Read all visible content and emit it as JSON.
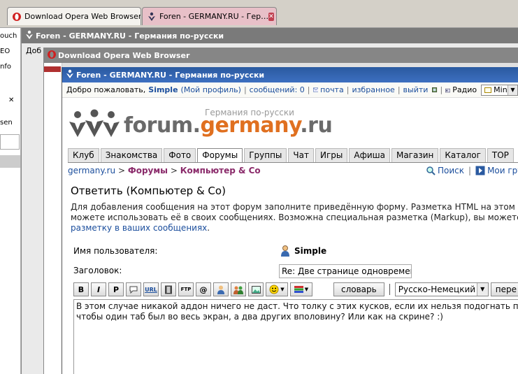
{
  "browser_tabs": [
    {
      "title": "Download Opera Web Browser",
      "active": true
    },
    {
      "title": "Foren - GERMANY.RU - Гер…",
      "active": false
    }
  ],
  "left_sliver": {
    "items": [
      "ouch",
      "EO",
      "nfo",
      "sen"
    ],
    "close_glyph": "✕"
  },
  "back_window1": {
    "title": "Foren - GERMANY.RU - Германия по-русски",
    "sub_text": "Доб"
  },
  "back_window2": {
    "title": "Download Opera Web Browser"
  },
  "window": {
    "title": "Foren - GERMANY.RU - Германия по-русски"
  },
  "welcome": {
    "greeting": "Добро пожаловать,",
    "user": "Simple",
    "profile": "(Мой профиль)",
    "messages": "сообщений: 0",
    "mail": "почта",
    "favorites": "избранное",
    "logout": "выйти",
    "radio": "Радио",
    "player_mode": "Mini"
  },
  "logo": {
    "tagline": "Германия по-русски",
    "part1": "forum.",
    "part2": "germany",
    "part3": ".ru"
  },
  "nav_tabs": [
    "Клуб",
    "Знакомства",
    "Фото",
    "Форумы",
    "Группы",
    "Чат",
    "Игры",
    "Афиша",
    "Магазин",
    "Каталог",
    "TOP"
  ],
  "nav_active": "Форумы",
  "breadcrumb": {
    "home": "germany.ru",
    "sep1": " > ",
    "forums": "Форумы",
    "sep2": " > ",
    "current": "Компьютер & Co"
  },
  "right_links": {
    "search": "Поиск",
    "my_groups": "Мои гру"
  },
  "page_title": "Ответить (Компьютер & Co)",
  "description": {
    "line1": "Для добавления сообщения на этот форум заполните приведённую форму. Разметка HTML на этом форуме",
    "line2": "можете использовать её в своих сообщениях. Возможна специальная разметка (Markup), вы можете испол",
    "line3_link": "разметку в ваших сообщениях",
    "line3_end": "."
  },
  "form": {
    "username_label": "Имя пользователя:",
    "username_value": "Simple",
    "subject_label": "Заголовок:",
    "subject_value": "Re: Две странице одновремено"
  },
  "toolbar": {
    "bold": "B",
    "italic": "I",
    "pre": "P",
    "url": "URL",
    "ftp": "FTP",
    "at": "@",
    "dictionary_button": "словарь",
    "dictionary_select": "Русско-Немецкий",
    "translate_button": "пере"
  },
  "message": {
    "body": "В этом случае никакой аддон ничего не даст. Что толку с этих кусков, если их нельзя подогнать по ширине?\nчтобы один таб был во весь экран, а два других вполовину? Или как на скрине? :)"
  },
  "colors": {
    "titlebar_active": "#3d6fc0",
    "titlebar_inactive": "#7a7a7a",
    "link": "#1a4d9c",
    "breadcrumb": "#8a2a6a",
    "brand_orange": "#e07020",
    "brand_grey": "#6a6a6a"
  }
}
